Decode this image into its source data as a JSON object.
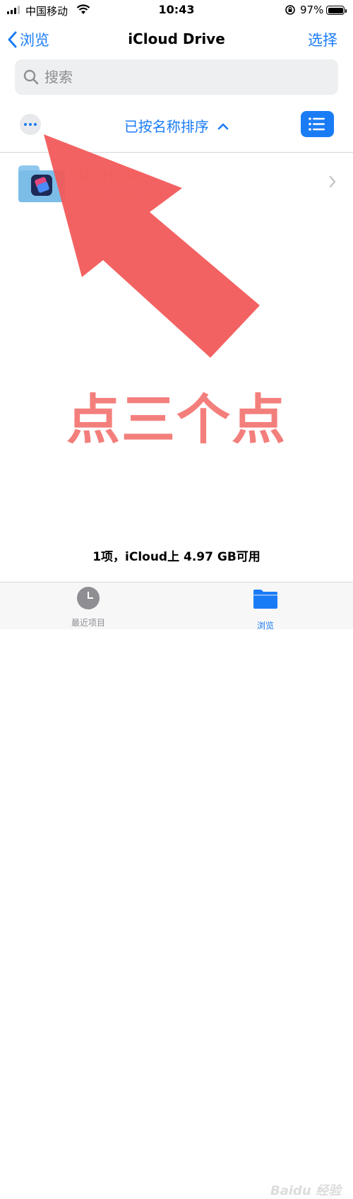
{
  "status_bar": {
    "carrier": "中国移动",
    "time": "10:43",
    "battery": "97%"
  },
  "nav": {
    "back_label": "浏览",
    "title": "iCloud Drive",
    "select_label": "选择"
  },
  "search": {
    "placeholder": "搜索"
  },
  "sort": {
    "label": "已按名称排序"
  },
  "files": [
    {
      "name": "Shortcuts",
      "meta": "2019/11/30 - 0 项"
    }
  ],
  "annotation": {
    "text": "点三个点"
  },
  "footer": {
    "summary": "1项，iCloud上 4.97 GB可用"
  },
  "tabbar": {
    "recent_label": "最近项目",
    "browse_label": "浏览"
  },
  "watermark": {
    "text": "Baidu 经验"
  },
  "colors": {
    "accent": "#1a7cf5",
    "annotation": "#f25a5a"
  }
}
